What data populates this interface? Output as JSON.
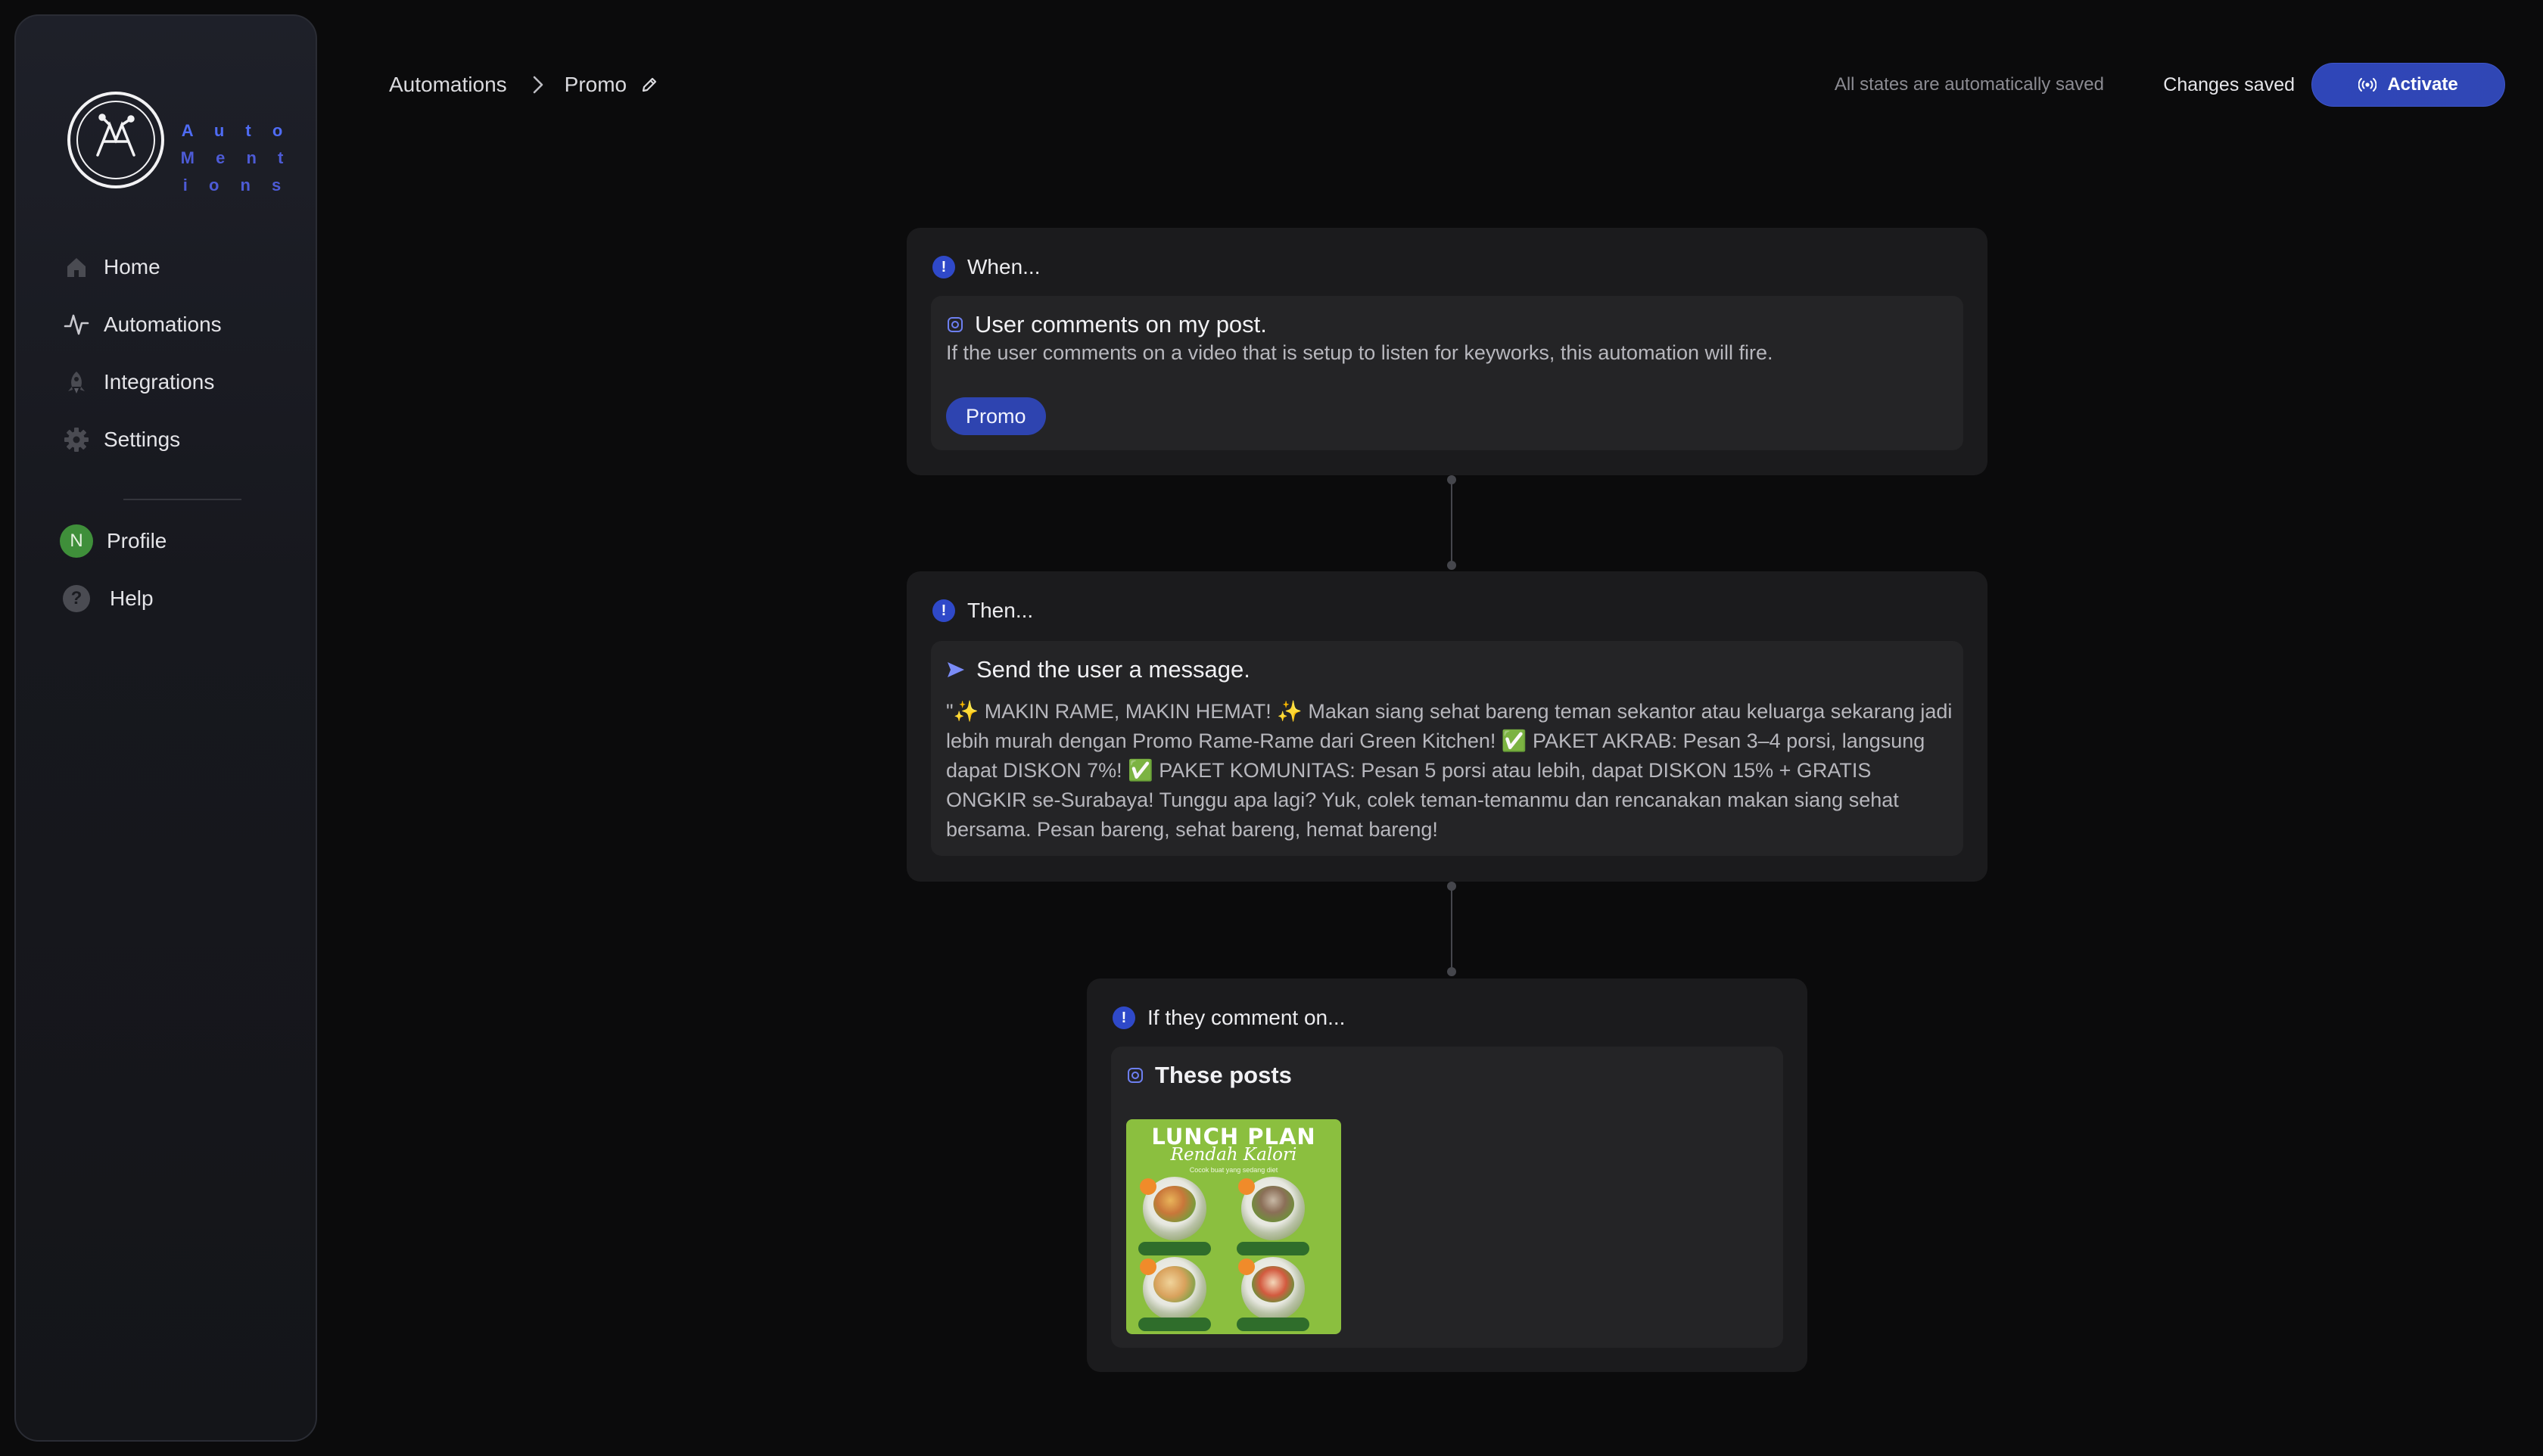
{
  "brand": {
    "line1": "A u t o",
    "line2": "M e n t i o n s"
  },
  "sidebar": {
    "items": [
      {
        "label": "Home",
        "icon": "home-icon"
      },
      {
        "label": "Automations",
        "icon": "activity-icon"
      },
      {
        "label": "Integrations",
        "icon": "rocket-icon"
      },
      {
        "label": "Settings",
        "icon": "gear-icon"
      }
    ],
    "profile": {
      "label": "Profile",
      "avatar_initial": "N",
      "avatar_color": "#3f8f3a"
    },
    "help": {
      "label": "Help",
      "icon_glyph": "?"
    }
  },
  "header": {
    "breadcrumb": [
      "Automations",
      "Promo"
    ],
    "autosave_note": "All states are automatically saved",
    "status": "Changes saved",
    "activate_label": "Activate"
  },
  "flow": {
    "trigger": {
      "heading": "When...",
      "title": "User comments on my post.",
      "description": "If the user comments on a video that is setup to listen for keyworks, this automation will fire.",
      "keyword": "Promo"
    },
    "action": {
      "heading": "Then...",
      "title": "Send the user a message.",
      "message": "\"✨ MAKIN RAME, MAKIN HEMAT! ✨ Makan siang sehat bareng teman sekantor atau keluarga sekarang jadi lebih murah dengan Promo Rame-Rame dari Green Kitchen! ✅ PAKET AKRAB: Pesan 3–4 porsi, langsung dapat DISKON 7%! ✅ PAKET KOMUNITAS: Pesan 5 porsi atau lebih, dapat DISKON 15% + GRATIS ONGKIR se-Surabaya! Tunggu apa lagi? Yuk, colek teman-temanmu dan rencanakan makan siang sehat bersama. Pesan bareng, sehat bareng, hemat bareng!"
    },
    "posts": {
      "heading": "If they comment on...",
      "title": "These posts",
      "thumb": {
        "title": "LUNCH PLAN",
        "subtitle": "Rendah Kalori",
        "tagline": "Cocok buat yang sedang diet",
        "background": "#8bbf3f"
      }
    }
  },
  "colors": {
    "accent": "#2f46b8",
    "background": "#0b0b0c",
    "card": "#1b1b1d",
    "card_inner": "#242426"
  }
}
